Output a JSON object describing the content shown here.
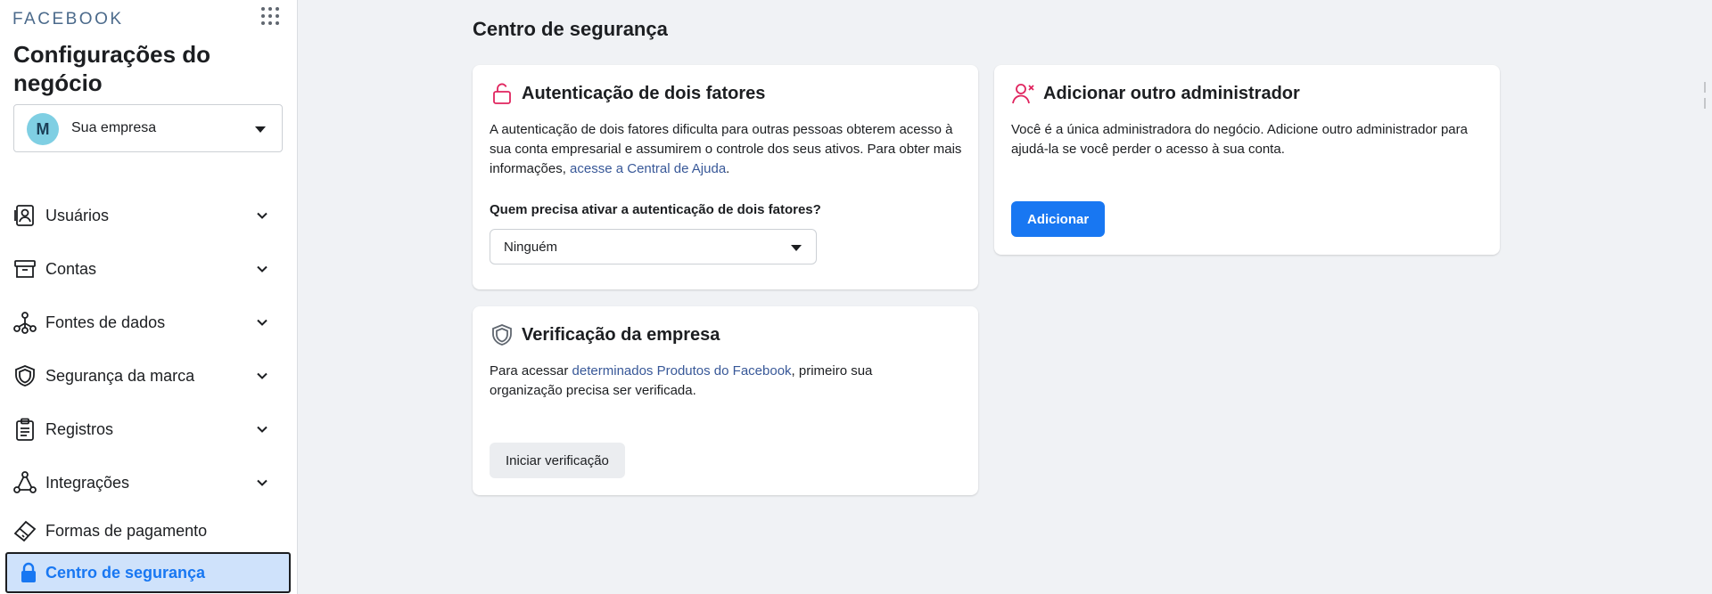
{
  "app": {
    "logo": "FACEBOOK",
    "apps_icon": "grid-icon"
  },
  "business": {
    "title": "Configurações do negócio",
    "account_initial": "M",
    "account_name": "Sua empresa"
  },
  "sidebar": {
    "items": [
      {
        "label": "Usuários",
        "icon": "users-id-icon"
      },
      {
        "label": "Contas",
        "icon": "box-icon"
      },
      {
        "label": "Fontes de dados",
        "icon": "data-nodes-icon"
      },
      {
        "label": "Segurança da marca",
        "icon": "shield-icon"
      },
      {
        "label": "Registros",
        "icon": "clipboard-icon"
      },
      {
        "label": "Integrações",
        "icon": "triangle-nodes-icon"
      },
      {
        "label": "Formas de pagamento",
        "icon": "card-icon"
      },
      {
        "label": "Centro de segurança",
        "icon": "lock-icon",
        "active": true
      }
    ]
  },
  "main": {
    "title": "Centro de segurança",
    "two_factor": {
      "title": "Autenticação de dois fatores",
      "text": "A autenticação de dois fatores dificulta para outras pessoas obterem acesso à sua conta empresarial e assumirem o controle dos seus ativos. Para obter mais informações,",
      "link": "acesse a Central de Ajuda",
      "after_link": ".",
      "question": "Quem precisa ativar a autenticação de dois fatores?",
      "selected": "Ninguém"
    },
    "verification": {
      "title": "Verificação da empresa",
      "text_before": "Para acessar",
      "link": "determinados Produtos do Facebook",
      "text_after": ", primeiro sua organização precisa ser verificada.",
      "button": "Iniciar verificação"
    },
    "admin": {
      "title": "Adicionar outro administrador",
      "text": "Você é a única administradora do negócio. Adicione outro administrador para ajudá-la se você perder o acesso à sua conta.",
      "button": "Adicionar"
    }
  },
  "colors": {
    "accent": "#1877f2",
    "link": "#385898",
    "active_bg": "#cfe2fb",
    "page_bg": "#f0f2f5",
    "alert": "#e0245e"
  }
}
